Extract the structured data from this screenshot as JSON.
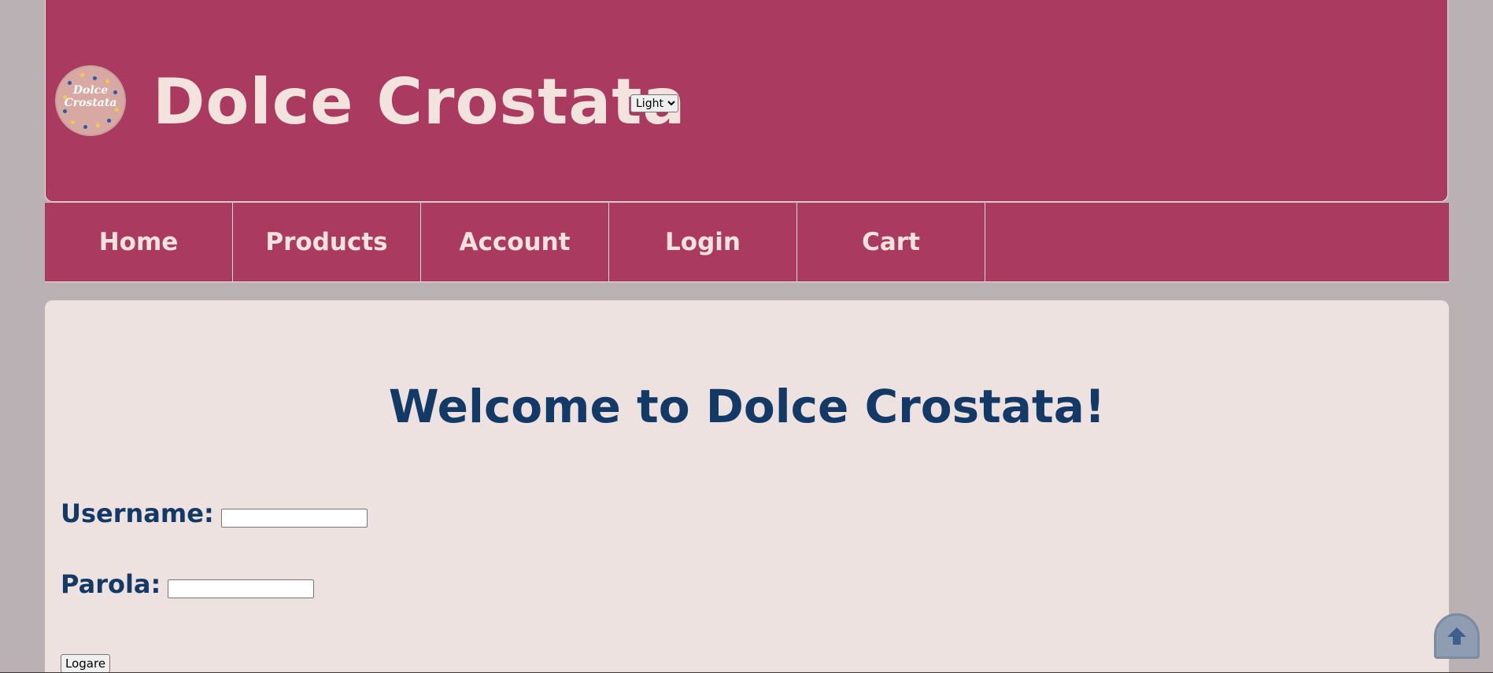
{
  "header": {
    "logo_text_line1": "Dolce",
    "logo_text_line2": "Crostata",
    "title": "Dolce Crostata",
    "theme_selected": "Light"
  },
  "nav": {
    "items": [
      {
        "label": "Home"
      },
      {
        "label": "Products"
      },
      {
        "label": "Account"
      },
      {
        "label": "Login"
      },
      {
        "label": "Cart"
      }
    ]
  },
  "main": {
    "welcome": "Welcome to Dolce Crostata!",
    "username_label": "Username:",
    "password_label": "Parola:",
    "submit_label": "Logare"
  },
  "icons": {
    "scroll_top": "arrow-up-icon"
  },
  "colors": {
    "brand": "#ab3a60",
    "background": "#bab1b4",
    "content_bg": "#ede2df",
    "heading": "#133a66",
    "light_text": "#f2e3df"
  }
}
